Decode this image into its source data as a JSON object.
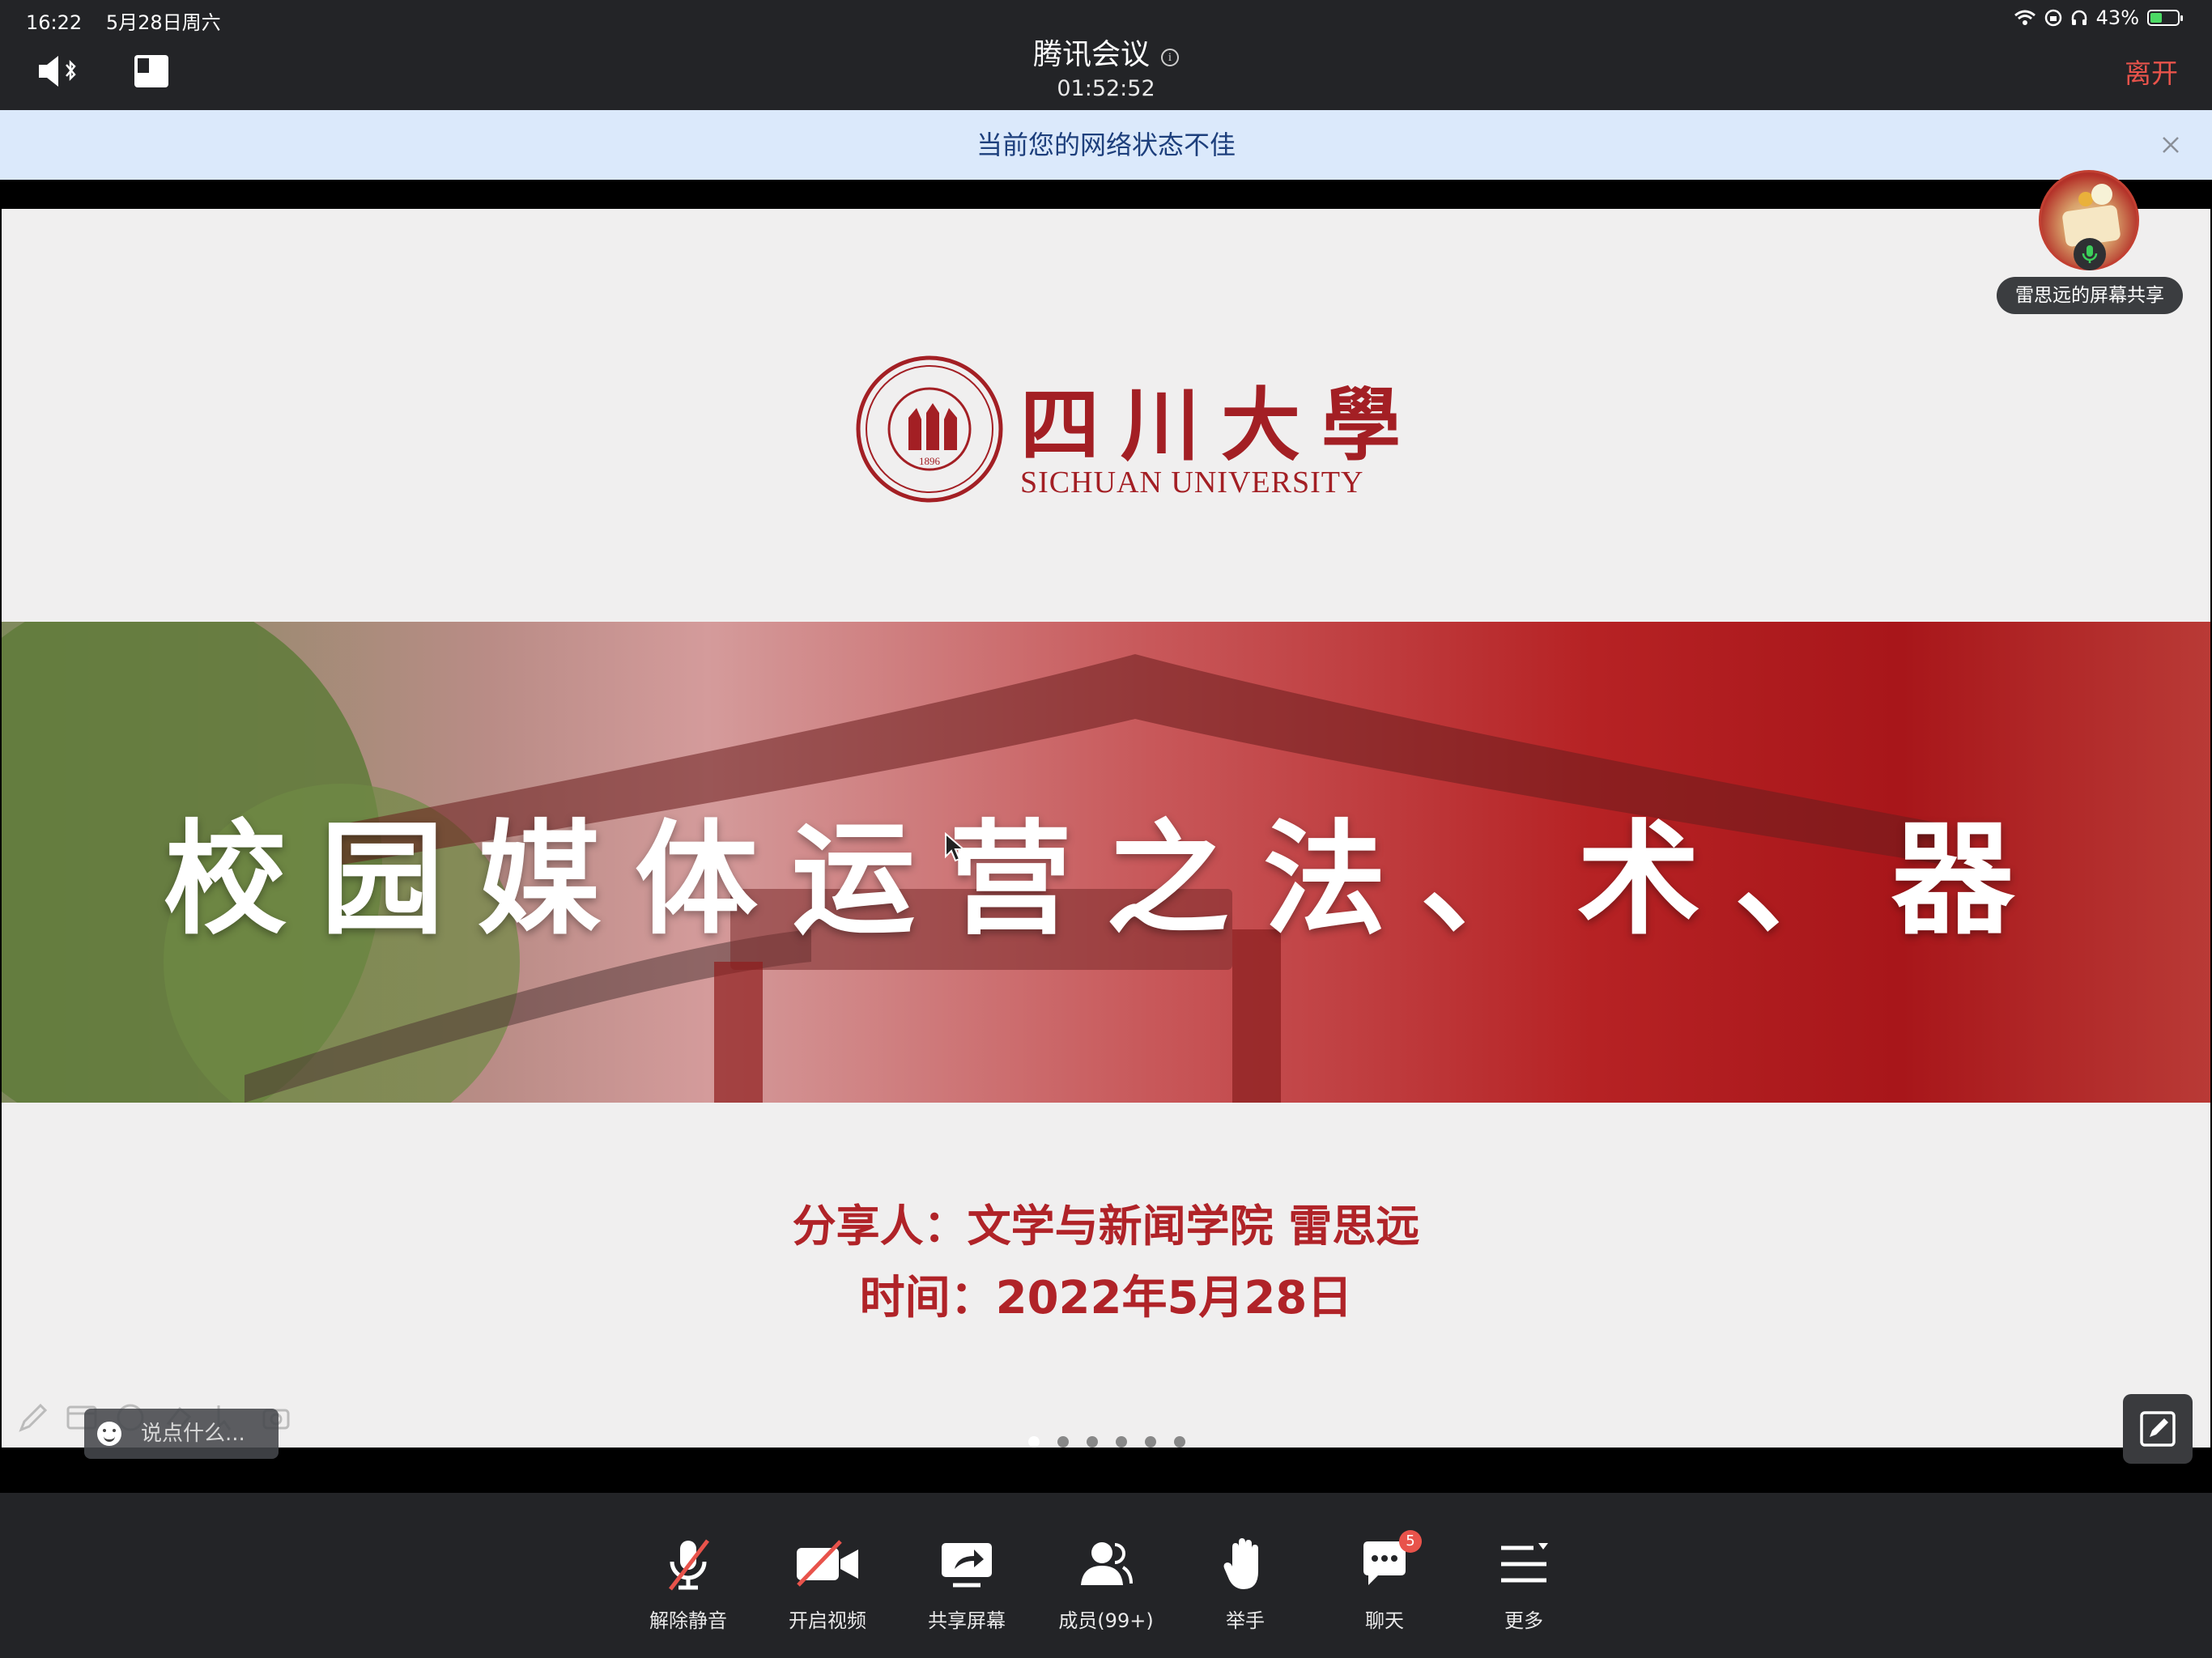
{
  "status_bar": {
    "time": "16:22",
    "date": "5月28日周六",
    "battery_percent": "43%",
    "battery_level": 0.43
  },
  "header": {
    "app_title": "腾讯会议",
    "elapsed": "01:52:52",
    "leave_label": "离开"
  },
  "network_banner": {
    "message": "当前您的网络状态不佳"
  },
  "slide": {
    "logo_cn": "四川大學",
    "logo_en": "SICHUAN UNIVERSITY",
    "seal_year": "1896",
    "banner_title": "校园媒体运营之法、术、器",
    "presenter_line": "分享人：文学与新闻学院  雷思远",
    "date_line": "时间：2022年5月28日"
  },
  "pager": {
    "total": 6,
    "current": 1
  },
  "chat_input": {
    "placeholder": "说点什么..."
  },
  "sharer": {
    "label": "雷思远的屏幕共享"
  },
  "toolbar": {
    "items": [
      {
        "label": "解除静音",
        "icon": "mic-muted-icon"
      },
      {
        "label": "开启视频",
        "icon": "video-off-icon"
      },
      {
        "label": "共享屏幕",
        "icon": "share-screen-icon"
      },
      {
        "label": "成员(99+)",
        "icon": "members-icon"
      },
      {
        "label": "举手",
        "icon": "raise-hand-icon"
      },
      {
        "label": "聊天",
        "icon": "chat-icon",
        "badge": "5"
      },
      {
        "label": "更多",
        "icon": "more-icon"
      }
    ]
  },
  "colors": {
    "accent_red": "#e8534b",
    "slide_red": "#b02328",
    "banner_bg": "#dbe9fb",
    "bar_bg": "#232427"
  }
}
